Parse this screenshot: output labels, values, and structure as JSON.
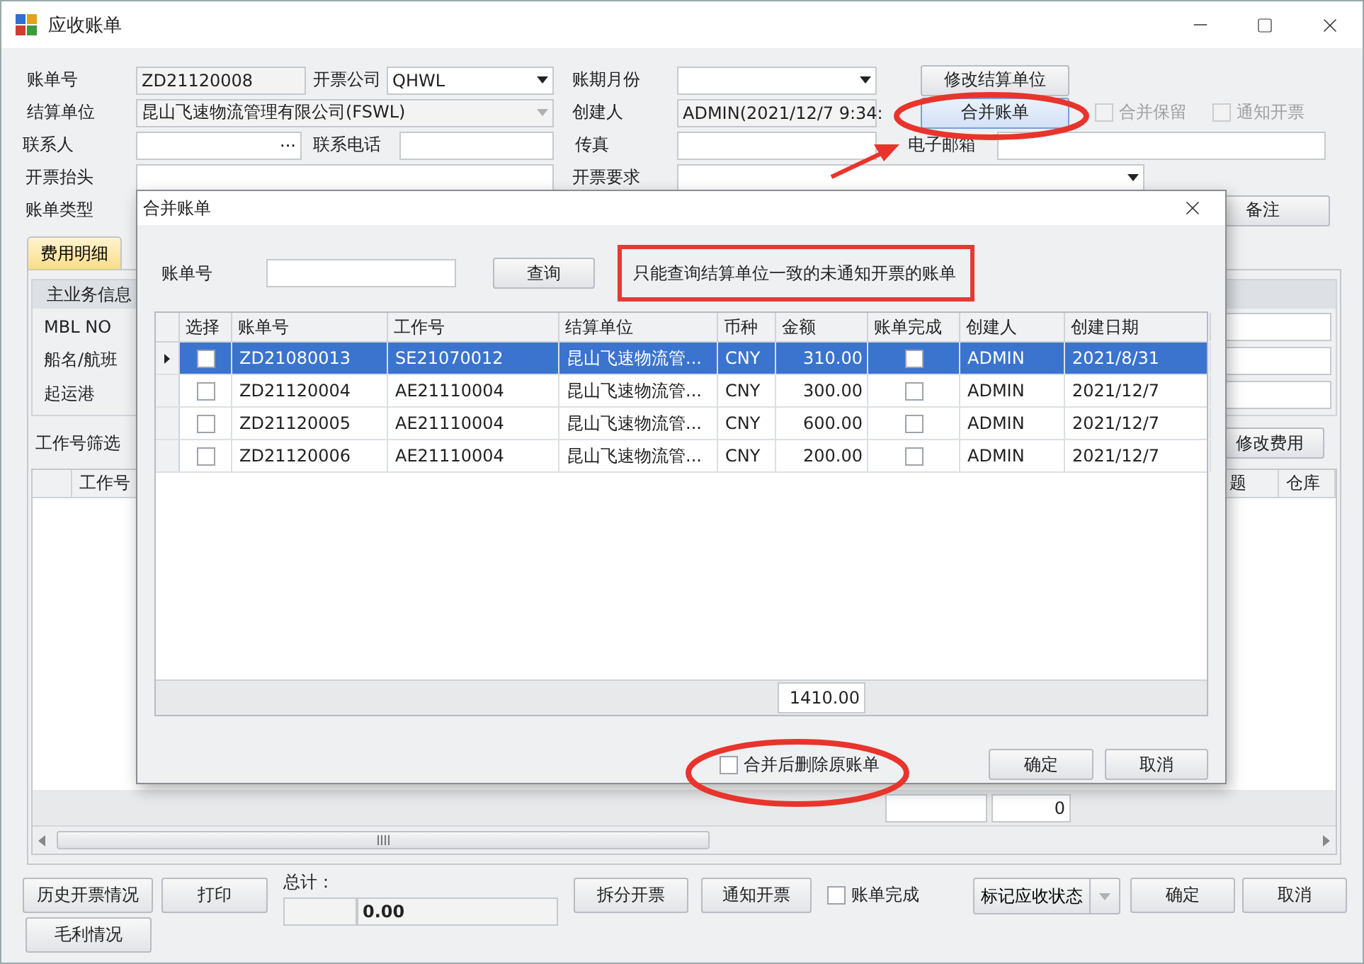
{
  "window": {
    "title": "应收账单"
  },
  "form": {
    "bill_no": {
      "label": "账单号",
      "value": "ZD21120008"
    },
    "invoice_company": {
      "label": "开票公司",
      "value": "QHWL"
    },
    "period": {
      "label": "账期月份"
    },
    "edit_unit_button": "修改结算单位",
    "settlement_unit": {
      "label": "结算单位",
      "value": "昆山飞速物流管理有限公司(FSWL)"
    },
    "creator": {
      "label": "创建人",
      "value": "ADMIN(2021/12/7 9:34:"
    },
    "merge_button": "合并账单",
    "options": [
      {
        "label": "合并保留",
        "checked": false,
        "disabled": true
      },
      {
        "label": "通知开票",
        "checked": false,
        "disabled": true
      }
    ],
    "contact": {
      "label": "联系人",
      "button": "···"
    },
    "phone": {
      "label": "联系电话"
    },
    "fax": {
      "label": "传真"
    },
    "email": {
      "label": "电子邮箱"
    },
    "invoice_title": {
      "label": "开票抬头"
    },
    "invoice_requirement": {
      "label": "开票要求"
    },
    "bill_type": {
      "label": "账单类型"
    },
    "remark_button": "备注"
  },
  "tabs": [
    {
      "label": "费用明细",
      "selected": true
    }
  ],
  "detail": {
    "group_title": "主业务信息",
    "info_fields": [
      "MBL NO",
      "船名/航班",
      "起运港"
    ],
    "filter_label": "工作号筛选",
    "edit_fee_button": "修改费用",
    "left_columns": [
      "工作号"
    ],
    "right_columns": [
      "题",
      "仓库"
    ],
    "footer_value": "0"
  },
  "bottom": {
    "history_button": "历史开票情况",
    "print_button": "打印",
    "profit_button": "毛利情况",
    "total": {
      "label": "总计：",
      "value": "0.00"
    },
    "split_button": "拆分开票",
    "notify_button": "通知开票",
    "complete": {
      "label": "账单完成",
      "checked": false
    },
    "status_button": "标记应收状态",
    "ok_button": "确定",
    "cancel_button": "取消"
  },
  "dialog": {
    "title": "合并账单",
    "search": {
      "label": "账单号"
    },
    "query_button": "查询",
    "notice": "只能查询结算单位一致的未通知开票的账单",
    "columns": [
      "选择",
      "账单号",
      "工作号",
      "结算单位",
      "币种",
      "金额",
      "账单完成",
      "创建人",
      "创建日期"
    ],
    "rows": [
      {
        "selected": true,
        "checked": false,
        "bill_no": "ZD21080013",
        "job_no": "SE21070012",
        "unit": "昆山飞速物流管...",
        "currency": "CNY",
        "amount": "310.00",
        "completed": false,
        "creator": "ADMIN",
        "date": "2021/8/31"
      },
      {
        "selected": false,
        "checked": false,
        "bill_no": "ZD21120004",
        "job_no": "AE21110004",
        "unit": "昆山飞速物流管...",
        "currency": "CNY",
        "amount": "300.00",
        "completed": false,
        "creator": "ADMIN",
        "date": "2021/12/7"
      },
      {
        "selected": false,
        "checked": false,
        "bill_no": "ZD21120005",
        "job_no": "AE21110004",
        "unit": "昆山飞速物流管...",
        "currency": "CNY",
        "amount": "600.00",
        "completed": false,
        "creator": "ADMIN",
        "date": "2021/12/7"
      },
      {
        "selected": false,
        "checked": false,
        "bill_no": "ZD21120006",
        "job_no": "AE21110004",
        "unit": "昆山飞速物流管...",
        "currency": "CNY",
        "amount": "200.00",
        "completed": false,
        "creator": "ADMIN",
        "date": "2021/12/7"
      }
    ],
    "total": "1410.00",
    "delete_original": {
      "label": "合并后删除原账单",
      "checked": false
    },
    "ok_button": "确定",
    "cancel_button": "取消"
  }
}
